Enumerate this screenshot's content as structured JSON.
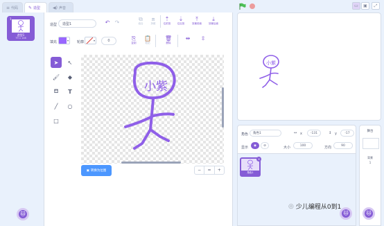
{
  "tabs": [
    {
      "label": "代码",
      "icon": "code-icon"
    },
    {
      "label": "造型",
      "icon": "brush-icon"
    },
    {
      "label": "声音",
      "icon": "speaker-icon"
    }
  ],
  "costume": {
    "number": "1",
    "name": "造型1",
    "size": "79 x 108"
  },
  "toolbar": {
    "costume_label": "造型",
    "costume_name": "造型1",
    "group_label": "组合",
    "ungroup_label": "拆散",
    "forward_label": "往前放",
    "backward_label": "往后放",
    "front_label": "放最前面",
    "back_label": "放最后面",
    "fill_label": "填充",
    "outline_label": "轮廓",
    "outline_width": "0",
    "copy_label": "复制",
    "paste_label": "粘贴",
    "delete_label": "删除",
    "flip_h_label": "",
    "flip_v_label": ""
  },
  "colors": {
    "fill": "#9966ff",
    "accent": "#855cd6",
    "drawing": "#8f5fe8"
  },
  "canvas": {
    "drawn_text": "小紫"
  },
  "convert_button_label": "转换为位图",
  "zoom": {
    "out": "−",
    "reset": "=",
    "in": "+"
  },
  "stage_text": "小紫",
  "sprite_info": {
    "sprite_label": "角色",
    "sprite_name": "角色1",
    "x_label": "x",
    "x_value": "-131",
    "y_label": "y",
    "y_value": "-17",
    "show_label": "显示",
    "size_label": "大小",
    "size_value": "100",
    "direction_label": "方向",
    "direction_value": "90"
  },
  "sprite_tile_name": "角色1",
  "stage_panel": {
    "title": "舞台",
    "backdrop_label": "背景",
    "backdrop_count": "1"
  },
  "watermark": "少儿编程从0到1"
}
